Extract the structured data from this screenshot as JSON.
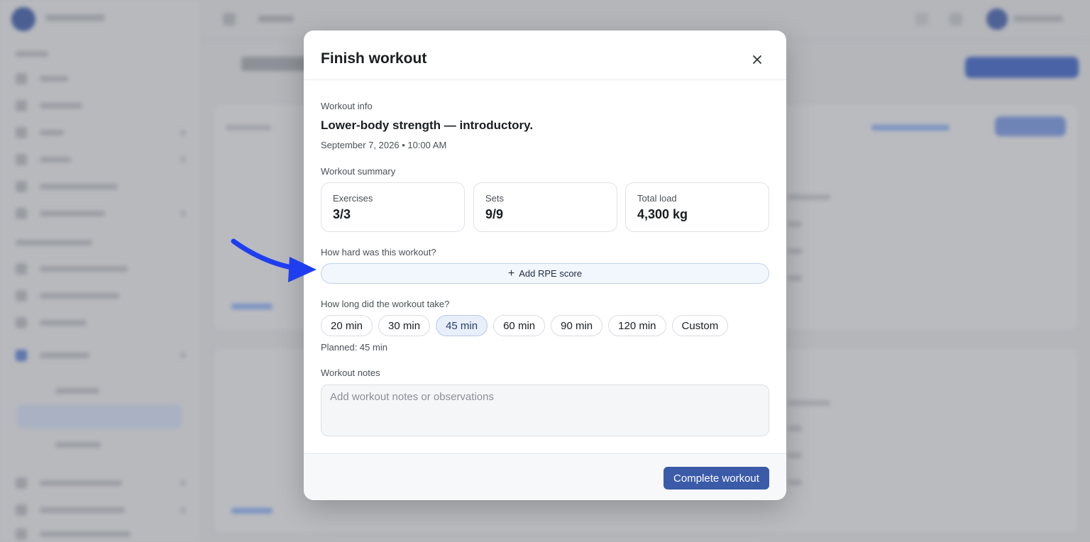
{
  "colors": {
    "accent": "#3b5ba8",
    "selected_chip_bg": "#e8effb",
    "rpe_button_bg": "#f2f6fd",
    "annotation_arrow": "#1f3ef0",
    "overlay": "#b4b6ba"
  },
  "modal": {
    "title": "Finish workout",
    "close_icon": "close-icon",
    "workout_info_label": "Workout info",
    "workout_name": "Lower-body strength — introductory.",
    "workout_datetime": "September 7, 2026 • 10:00 AM",
    "summary_label": "Workout summary",
    "summary": [
      {
        "label": "Exercises",
        "value": "3/3"
      },
      {
        "label": "Sets",
        "value": "9/9"
      },
      {
        "label": "Total load",
        "value": "4,300 kg"
      }
    ],
    "rpe_question": "How hard was this workout?",
    "rpe_button_icon": "plus-icon",
    "rpe_button_label": "Add RPE score",
    "duration_question": "How long did the workout take?",
    "duration_options": [
      "20 min",
      "30 min",
      "45 min",
      "60 min",
      "90 min",
      "120 min",
      "Custom"
    ],
    "duration_selected": "45 min",
    "planned": "Planned: 45 min",
    "notes_label": "Workout notes",
    "notes_placeholder": "Add workout notes or observations",
    "notes_value": "",
    "complete_button": "Complete workout"
  },
  "annotation": {
    "icon": "arrow-pointer-icon"
  }
}
